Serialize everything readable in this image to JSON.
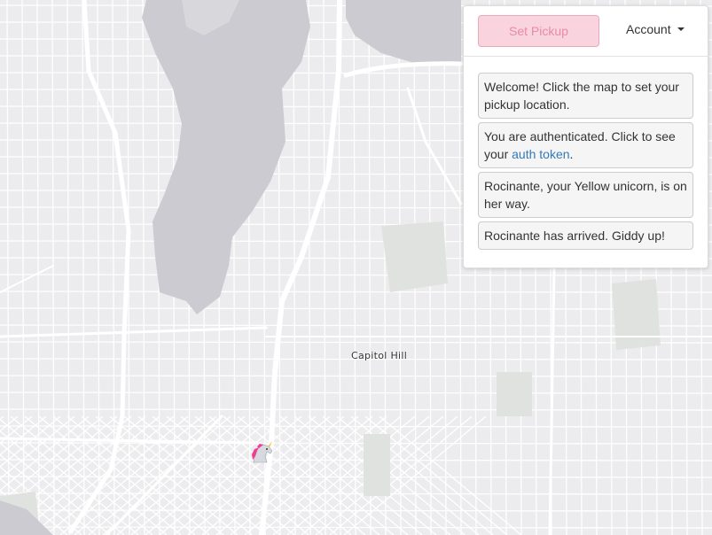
{
  "map": {
    "label": "Capitol Hill",
    "marker_icon": "unicorn-icon",
    "colors": {
      "land": "#ececee",
      "water": "#cccbd1",
      "street": "#ffffff",
      "park": "#e1e2e1"
    }
  },
  "panel": {
    "pickup_label": "Set Pickup",
    "account_label": "Account",
    "messages": {
      "welcome": "Welcome! Click the map to set your pickup location.",
      "auth_prefix": "You are authenticated. Click to see your ",
      "auth_link": "auth token",
      "auth_suffix": ".",
      "on_way": "Rocinante, your Yellow unicorn, is on her way.",
      "arrived": "Rocinante has arrived. Giddy up!"
    }
  }
}
